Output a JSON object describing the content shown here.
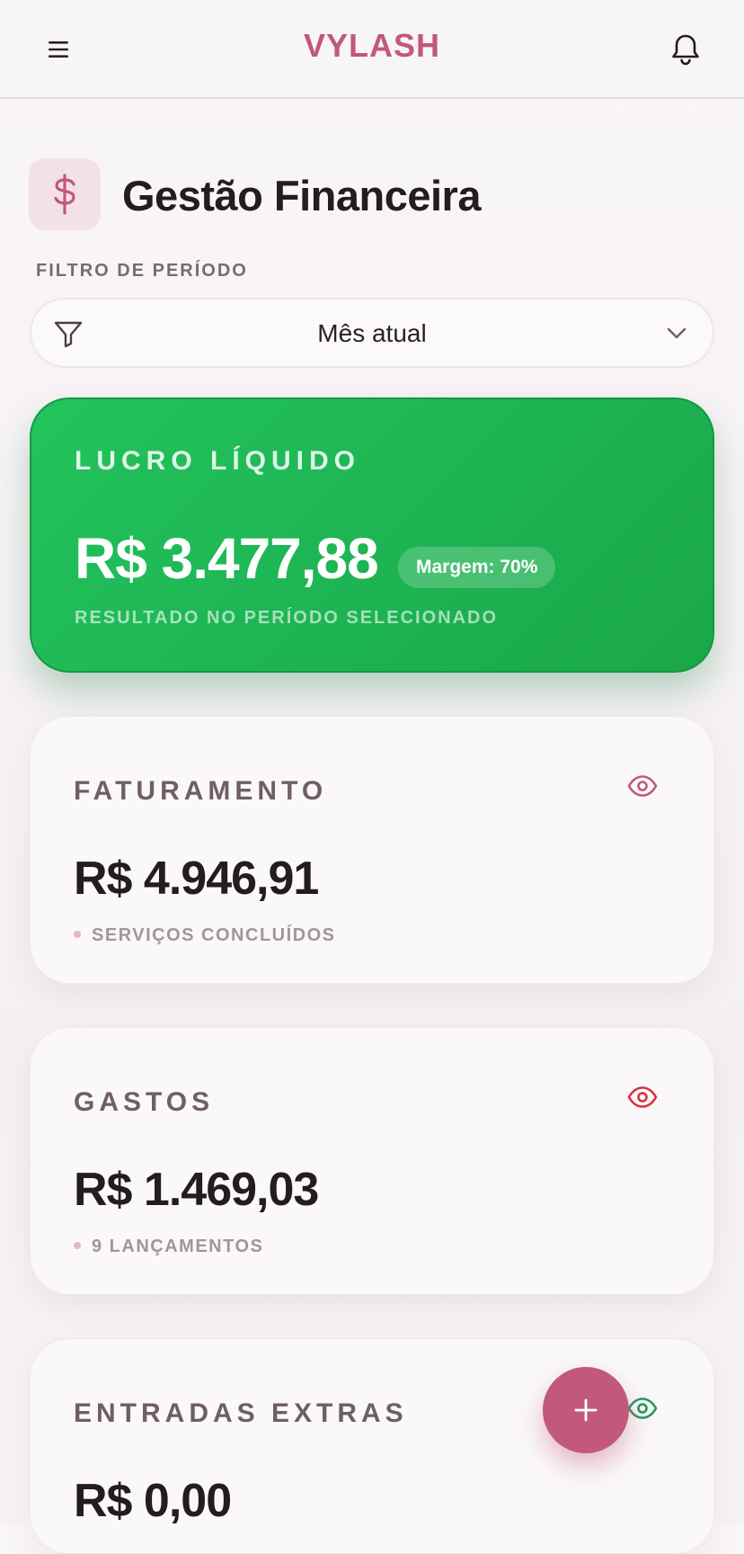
{
  "app": {
    "brand": "VYLASH"
  },
  "header": {
    "menu_icon": "hamburger-icon",
    "notification_icon": "bell-icon"
  },
  "page": {
    "icon": "dollar-icon",
    "title": "Gestão Financeira"
  },
  "filter": {
    "label": "FILTRO DE PERÍODO",
    "selected": "Mês atual",
    "icon": "filter-icon"
  },
  "profit": {
    "label": "LUCRO LÍQUIDO",
    "value": "R$ 3.477,88",
    "margin": "Margem: 70%",
    "subtitle": "RESULTADO NO PERÍODO SELECIONADO",
    "color": "#1eb352"
  },
  "revenue": {
    "label": "FATURAMENTO",
    "value": "R$ 4.946,91",
    "subtitle": "SERVIÇOS CONCLUÍDOS",
    "eye_color": "#c2587e"
  },
  "expenses": {
    "label": "GASTOS",
    "value": "R$ 1.469,03",
    "subtitle": "9 LANÇAMENTOS",
    "eye_color": "#d6343f"
  },
  "extra_income": {
    "label": "ENTRADAS EXTRAS",
    "value": "R$ 0,00",
    "eye_color": "#1f9a5a"
  },
  "fab": {
    "icon": "plus-icon",
    "color": "#c2587e"
  }
}
